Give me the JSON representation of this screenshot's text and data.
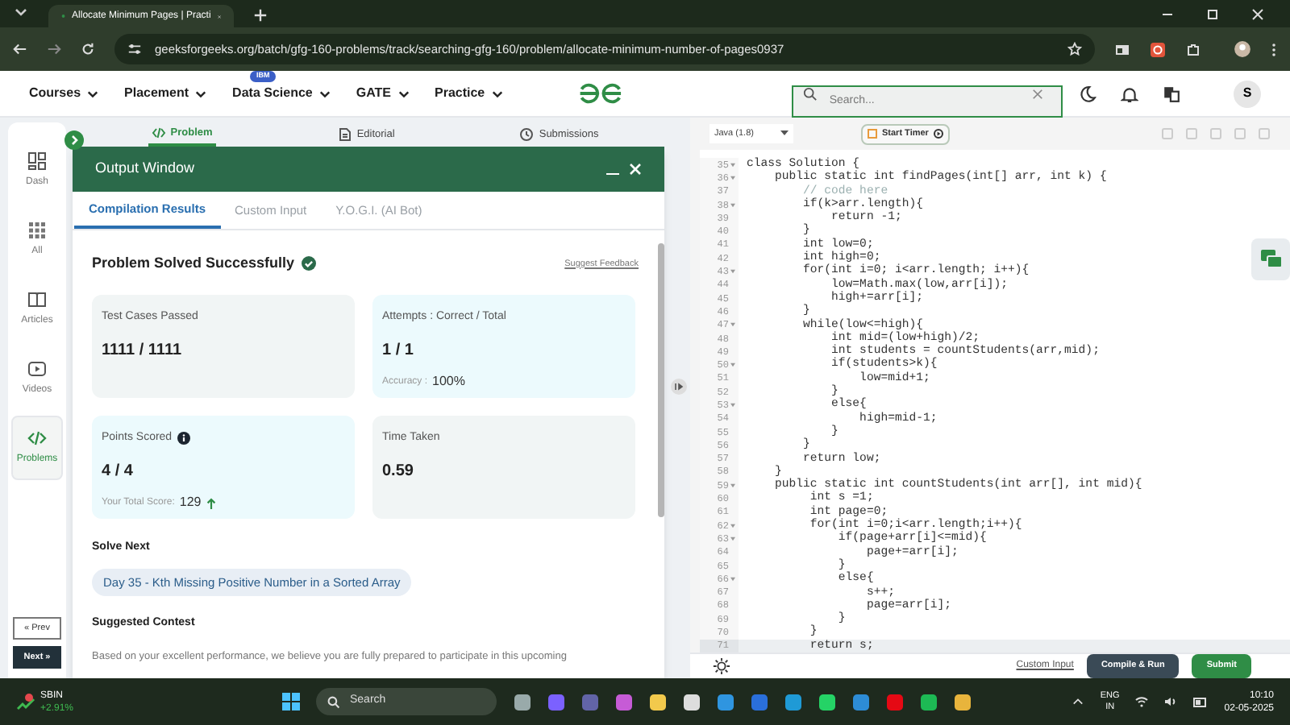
{
  "browser": {
    "tab_title": "Allocate Minimum Pages | Practi",
    "url": "geeksforgeeks.org/batch/gfg-160-problems/track/searching-gfg-160/problem/allocate-minimum-number-of-pages0937"
  },
  "site_nav": {
    "items": [
      {
        "label": "Courses"
      },
      {
        "label": "Placement"
      },
      {
        "label": "Data Science",
        "badge": "IBM"
      },
      {
        "label": "GATE"
      },
      {
        "label": "Practice"
      }
    ],
    "search_placeholder": "Search...",
    "avatar": "S"
  },
  "sidebar": {
    "items": [
      {
        "label": "Dash",
        "kind": "dash",
        "selected": false
      },
      {
        "label": "All",
        "kind": "grid",
        "selected": false
      },
      {
        "label": "Articles",
        "kind": "book",
        "selected": false
      },
      {
        "label": "Videos",
        "kind": "video",
        "selected": false
      },
      {
        "label": "Problems",
        "kind": "code",
        "selected": true
      }
    ],
    "prev": "« Prev",
    "next": "Next »"
  },
  "problem_tabs": [
    {
      "label": "Problem",
      "kind": "code",
      "selected": true
    },
    {
      "label": "Editorial",
      "kind": "doc",
      "selected": false
    },
    {
      "label": "Submissions",
      "kind": "clock",
      "selected": false
    }
  ],
  "output_window": {
    "title": "Output Window",
    "tabs": [
      {
        "label": "Compilation Results",
        "selected": true
      },
      {
        "label": "Custom Input",
        "selected": false
      },
      {
        "label": "Y.O.G.I. (AI Bot)",
        "selected": false
      }
    ],
    "status": "Problem Solved Successfully",
    "feedback": "Suggest Feedback",
    "cards": [
      {
        "label": "Test Cases Passed",
        "value": "1111 / 1111",
        "color": "#f1f5f5"
      },
      {
        "label": "Attempts : Correct / Total",
        "value": "1 / 1",
        "sub_label": "Accuracy :",
        "sub_value": "100%",
        "color": "#ecfafd"
      },
      {
        "label": "Points Scored",
        "info": true,
        "value": "4 / 4",
        "sub_label": "Your Total Score:",
        "sub_value": "129",
        "rising": true,
        "color": "#ecfafd"
      },
      {
        "label": "Time Taken",
        "value": "0.59",
        "color": "#f1f5f5"
      }
    ],
    "solve_next": {
      "heading": "Solve Next",
      "link": "Day 35 - Kth Missing Positive Number in a Sorted Array"
    },
    "suggested_contest": {
      "heading": "Suggested Contest",
      "text": "Based on your excellent performance, we believe you are fully prepared to participate in this upcoming"
    }
  },
  "editor": {
    "language": "Java (1.8)",
    "timer": "Start Timer",
    "custom_input": "Custom Input",
    "compile": "Compile & Run",
    "submit": "Submit",
    "lines": [
      {
        "num": "35",
        "text": "class Solution {",
        "kind": "code",
        "fold": true,
        "active": false
      },
      {
        "num": "36",
        "text": "    public static int findPages(int[] arr, int k) {",
        "kind": "code",
        "fold": true,
        "active": false
      },
      {
        "num": "37",
        "text": "        // code here",
        "kind": "comment",
        "fold": false,
        "active": false
      },
      {
        "num": "38",
        "text": "        if(k>arr.length){",
        "kind": "code",
        "fold": true,
        "active": false
      },
      {
        "num": "39",
        "text": "            return -1;",
        "kind": "code",
        "fold": false,
        "active": false
      },
      {
        "num": "40",
        "text": "        }",
        "kind": "code",
        "fold": false,
        "active": false
      },
      {
        "num": "41",
        "text": "        int low=0;",
        "kind": "code",
        "fold": false,
        "active": false
      },
      {
        "num": "42",
        "text": "        int high=0;",
        "kind": "code",
        "fold": false,
        "active": false
      },
      {
        "num": "43",
        "text": "        for(int i=0; i<arr.length; i++){",
        "kind": "code",
        "fold": true,
        "active": false
      },
      {
        "num": "44",
        "text": "            low=Math.max(low,arr[i]);",
        "kind": "code",
        "fold": false,
        "active": false
      },
      {
        "num": "45",
        "text": "            high+=arr[i];",
        "kind": "code",
        "fold": false,
        "active": false
      },
      {
        "num": "46",
        "text": "        }",
        "kind": "code",
        "fold": false,
        "active": false
      },
      {
        "num": "47",
        "text": "        while(low<=high){",
        "kind": "code",
        "fold": true,
        "active": false
      },
      {
        "num": "48",
        "text": "            int mid=(low+high)/2;",
        "kind": "code",
        "fold": false,
        "active": false
      },
      {
        "num": "49",
        "text": "            int students = countStudents(arr,mid);",
        "kind": "code",
        "fold": false,
        "active": false
      },
      {
        "num": "50",
        "text": "            if(students>k){",
        "kind": "code",
        "fold": true,
        "active": false
      },
      {
        "num": "51",
        "text": "                low=mid+1;",
        "kind": "code",
        "fold": false,
        "active": false
      },
      {
        "num": "52",
        "text": "            }",
        "kind": "code",
        "fold": false,
        "active": false
      },
      {
        "num": "53",
        "text": "            else{",
        "kind": "code",
        "fold": true,
        "active": false
      },
      {
        "num": "54",
        "text": "                high=mid-1;",
        "kind": "code",
        "fold": false,
        "active": false
      },
      {
        "num": "55",
        "text": "            }",
        "kind": "code",
        "fold": false,
        "active": false
      },
      {
        "num": "56",
        "text": "        }",
        "kind": "code",
        "fold": false,
        "active": false
      },
      {
        "num": "57",
        "text": "        return low;",
        "kind": "code",
        "fold": false,
        "active": false
      },
      {
        "num": "58",
        "text": "    }",
        "kind": "code",
        "fold": false,
        "active": false
      },
      {
        "num": "59",
        "text": "    public static int countStudents(int arr[], int mid){",
        "kind": "code",
        "fold": true,
        "active": false
      },
      {
        "num": "60",
        "text": "         int s =1;",
        "kind": "code",
        "fold": false,
        "active": false
      },
      {
        "num": "61",
        "text": "         int page=0;",
        "kind": "code",
        "fold": false,
        "active": false
      },
      {
        "num": "62",
        "text": "         for(int i=0;i<arr.length;i++){",
        "kind": "code",
        "fold": true,
        "active": false
      },
      {
        "num": "63",
        "text": "             if(page+arr[i]<=mid){",
        "kind": "code",
        "fold": true,
        "active": false
      },
      {
        "num": "64",
        "text": "                 page+=arr[i];",
        "kind": "code",
        "fold": false,
        "active": false
      },
      {
        "num": "65",
        "text": "             }",
        "kind": "code",
        "fold": false,
        "active": false
      },
      {
        "num": "66",
        "text": "             else{",
        "kind": "code",
        "fold": true,
        "active": false
      },
      {
        "num": "67",
        "text": "                 s++;",
        "kind": "code",
        "fold": false,
        "active": false
      },
      {
        "num": "68",
        "text": "                 page=arr[i];",
        "kind": "code",
        "fold": false,
        "active": false
      },
      {
        "num": "69",
        "text": "             }",
        "kind": "code",
        "fold": false,
        "active": false
      },
      {
        "num": "70",
        "text": "         }",
        "kind": "code",
        "fold": false,
        "active": false
      },
      {
        "num": "71",
        "text": "         return s;",
        "kind": "code",
        "fold": false,
        "active": true
      }
    ]
  },
  "taskbar": {
    "stock": {
      "symbol": "SBIN",
      "change": "+2.91%"
    },
    "search": "Search",
    "language": "ENG",
    "region": "IN",
    "time": "10:10",
    "date": "02-05-2025"
  }
}
